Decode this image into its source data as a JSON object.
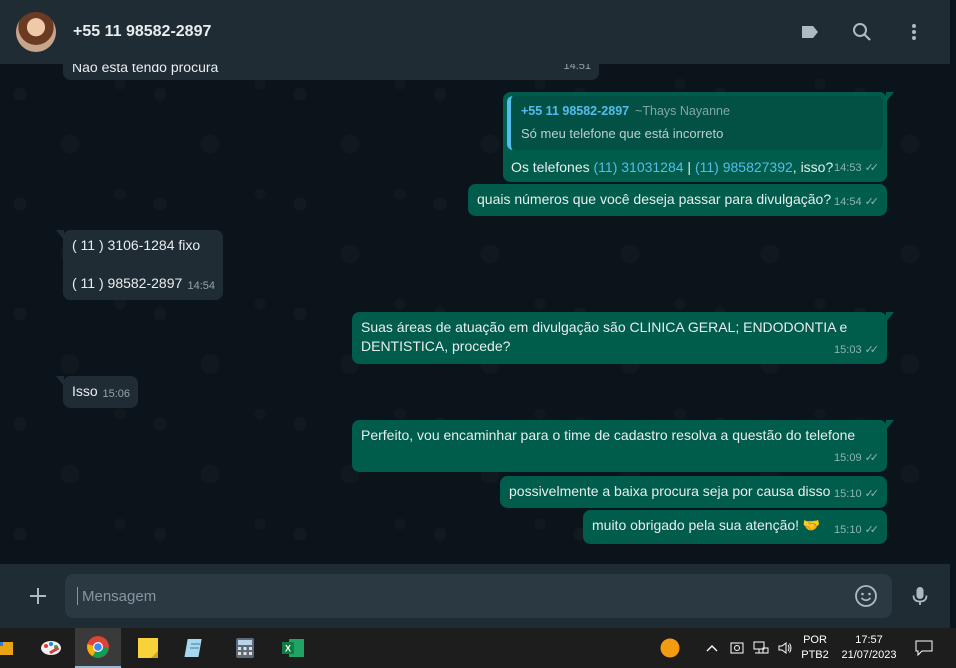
{
  "header": {
    "contact_name": "+55 11 98582-2897"
  },
  "messages": [
    {
      "id": "m0",
      "type": "in",
      "text": "Não está tendo procura",
      "time": "14:51"
    },
    {
      "id": "m1",
      "type": "out",
      "quote_author": "+55 11 98582-2897",
      "quote_alias": "~Thays Nayanne",
      "quote_text": "Só meu telefone que está incorreto",
      "text_pre": "Os telefones ",
      "link1": "(11) 31031284",
      "sep": " | ",
      "link2": "(11) 985827392",
      "text_post": ", isso?",
      "time": "14:53"
    },
    {
      "id": "m2",
      "type": "out",
      "text": "quais números que você deseja passar para divulgação?",
      "time": "14:54"
    },
    {
      "id": "m3",
      "type": "in",
      "line1": "( 11 ) 3106-1284 fixo",
      "line2": "( 11 ) 98582-2897",
      "time": "14:54"
    },
    {
      "id": "m4",
      "type": "out",
      "line1": "Suas áreas de atuação em divulgação são CLINICA GERAL; ENDODONTIA e",
      "line2": "DENTISTICA, procede?",
      "time": "15:03"
    },
    {
      "id": "m5",
      "type": "in",
      "text": "Isso",
      "time": "15:06"
    },
    {
      "id": "m6",
      "type": "out",
      "text": "Perfeito, vou encaminhar para o time de cadastro resolva a questão do telefone",
      "time": "15:09"
    },
    {
      "id": "m7",
      "type": "out",
      "text": "possivelmente a baixa procura seja por causa disso",
      "time": "15:10"
    },
    {
      "id": "m8",
      "type": "out",
      "text": "muito obrigado pela sua atenção! 🤝",
      "time": "15:10"
    }
  ],
  "composer": {
    "placeholder": "Mensagem"
  },
  "taskbar": {
    "lang_top": "POR",
    "lang_bottom": "PTB2",
    "time": "17:57",
    "date": "21/07/2023"
  },
  "colors": {
    "chat_bg": "#0b141a",
    "bubble_out": "#005c4b",
    "bubble_in": "#202c33",
    "link": "#53bdeb",
    "header": "#202c33"
  }
}
